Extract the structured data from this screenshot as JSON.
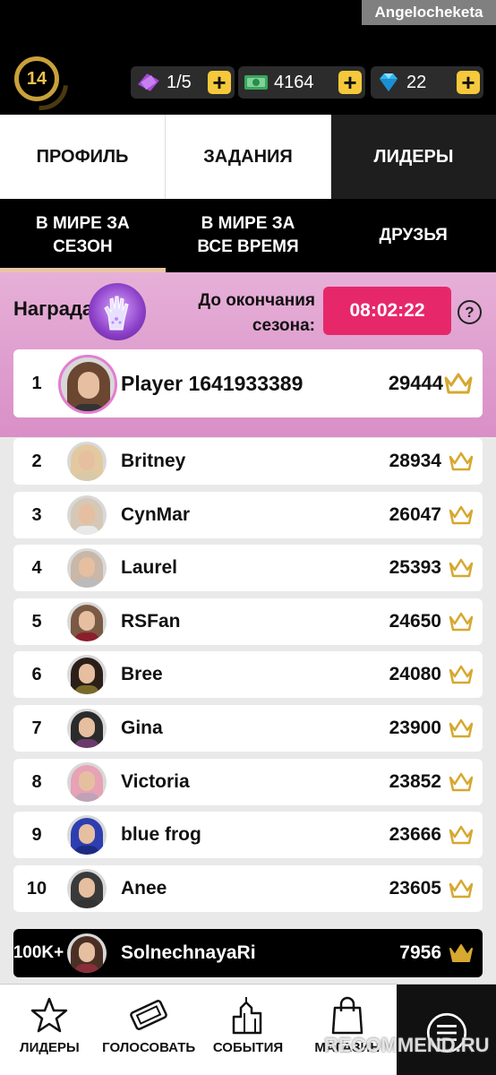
{
  "watermark": "Angelocheketa",
  "header": {
    "level": "14",
    "tickets": "1/5",
    "cash": "4164",
    "gems": "22",
    "plus": "+"
  },
  "main_tabs": [
    {
      "label": "ПРОФИЛЬ",
      "active": false
    },
    {
      "label": "ЗАДАНИЯ",
      "active": false
    },
    {
      "label": "ЛИДЕРЫ",
      "active": true
    }
  ],
  "sub_tabs": [
    {
      "label": "В МИРЕ ЗА СЕЗОН",
      "active": true
    },
    {
      "label": "В МИРЕ ЗА ВСЕ ВРЕМЯ",
      "active": false
    },
    {
      "label": "ДРУЗЬЯ",
      "active": false
    }
  ],
  "season": {
    "reward_label": "Награда",
    "ends_label": "До окончания сезона:",
    "timer": "08:02:22",
    "help": "?"
  },
  "top_player": {
    "rank": "1",
    "name": "Player 1641933389",
    "score": "29444"
  },
  "leaders": [
    {
      "rank": "2",
      "name": "Britney",
      "score": "28934"
    },
    {
      "rank": "3",
      "name": "CynMar",
      "score": "26047"
    },
    {
      "rank": "4",
      "name": "Laurel",
      "score": "25393"
    },
    {
      "rank": "5",
      "name": "RSFan",
      "score": "24650"
    },
    {
      "rank": "6",
      "name": "Bree",
      "score": "24080"
    },
    {
      "rank": "7",
      "name": "Gina",
      "score": "23900"
    },
    {
      "rank": "8",
      "name": "Victoria",
      "score": "23852"
    },
    {
      "rank": "9",
      "name": "blue frog",
      "score": "23666"
    },
    {
      "rank": "10",
      "name": "Anee",
      "score": "23605"
    }
  ],
  "me": {
    "rank": "100K+",
    "name": "SolnechnayaRi",
    "score": "7956"
  },
  "bottom_nav": [
    {
      "label": "ЛИДЕРЫ",
      "icon": "star-icon"
    },
    {
      "label": "ГОЛОСОВАТЬ",
      "icon": "ticket-icon"
    },
    {
      "label": "СОБЫТИЯ",
      "icon": "city-icon"
    },
    {
      "label": "МАГАЗИН",
      "icon": "shopping-bag-icon"
    },
    {
      "label": "",
      "icon": "menu-icon"
    }
  ],
  "recommend_watermark": "RECOMMEND.RU",
  "colors": {
    "accent_pink": "#e6286b",
    "panel_pink": "#d98fc6",
    "gold": "#f5c93b",
    "crown": "#e0b23a"
  }
}
